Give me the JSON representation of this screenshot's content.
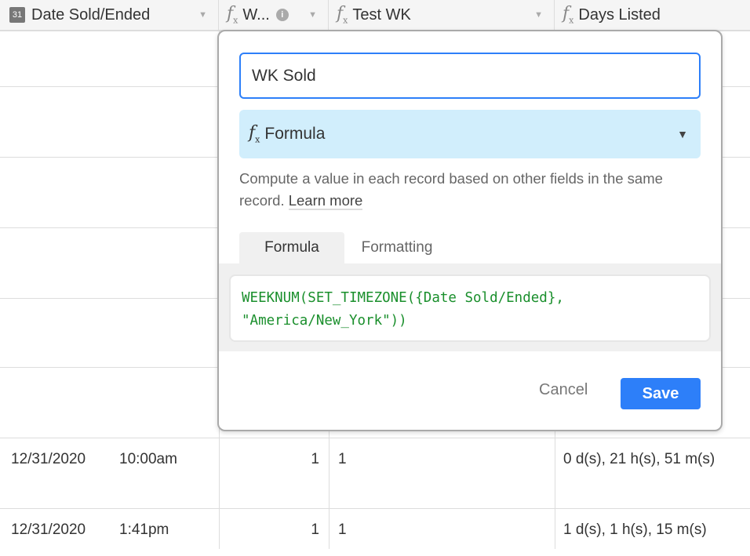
{
  "columns": [
    {
      "label": "Date Sold/Ended",
      "icon": "calendar-icon",
      "icon_text": "31"
    },
    {
      "label": "W...",
      "icon": "formula-icon"
    },
    {
      "label": "Test WK",
      "icon": "formula-icon"
    },
    {
      "label": "Days Listed",
      "icon": "formula-icon"
    }
  ],
  "rows": [
    {
      "date": "12/31/2020",
      "time": "10:00am",
      "wk": "1",
      "test_wk": "1",
      "days_listed": "0 d(s), 21 h(s), 51 m(s)"
    },
    {
      "date": "12/31/2020",
      "time": "1:41pm",
      "wk": "1",
      "test_wk": "1",
      "days_listed": "1 d(s), 1 h(s), 15 m(s)"
    }
  ],
  "popup": {
    "field_name": "WK Sold",
    "field_type": "Formula",
    "description": "Compute a value in each record based on other fields in the same record.",
    "learn_more": "Learn more",
    "tabs": [
      "Formula",
      "Formatting"
    ],
    "formula": "WEEKNUM(SET_TIMEZONE({Date Sold/Ended},\n\"America/New_York\"))",
    "cancel": "Cancel",
    "save": "Save"
  },
  "colors": {
    "accent": "#2d7ff9",
    "formula_text": "#1a8f2c",
    "type_bg": "#d1eefc"
  }
}
